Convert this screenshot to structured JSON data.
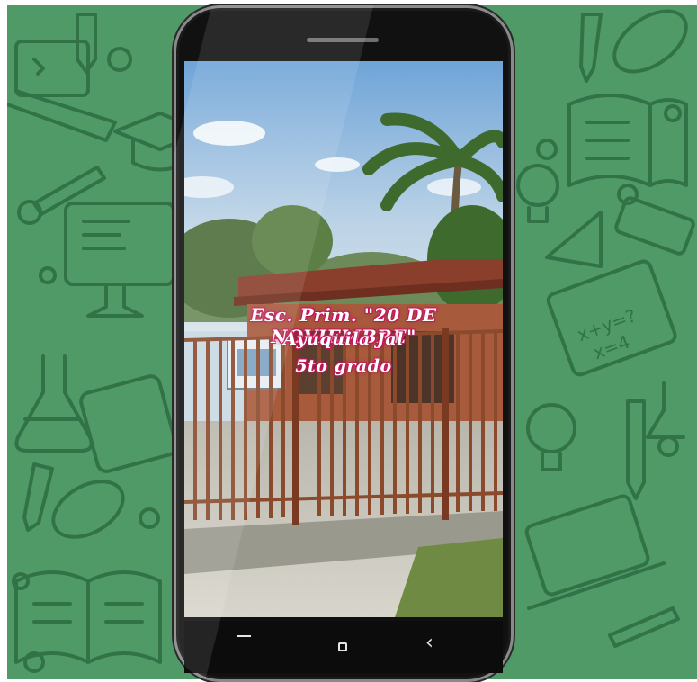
{
  "video": {
    "line1": "Esc. Prim. \"20 DE NOVIEMBRE\"",
    "line2": "Ayuquila Jal",
    "line3": "5to grado"
  },
  "navigation": {
    "recent_icon": "recent-apps-icon",
    "home_icon": "home-icon",
    "back_icon": "back-icon"
  },
  "colors": {
    "background_green": "#4f9a66",
    "doodle_green": "#2f6e44",
    "text_glow": "#c2185b"
  }
}
